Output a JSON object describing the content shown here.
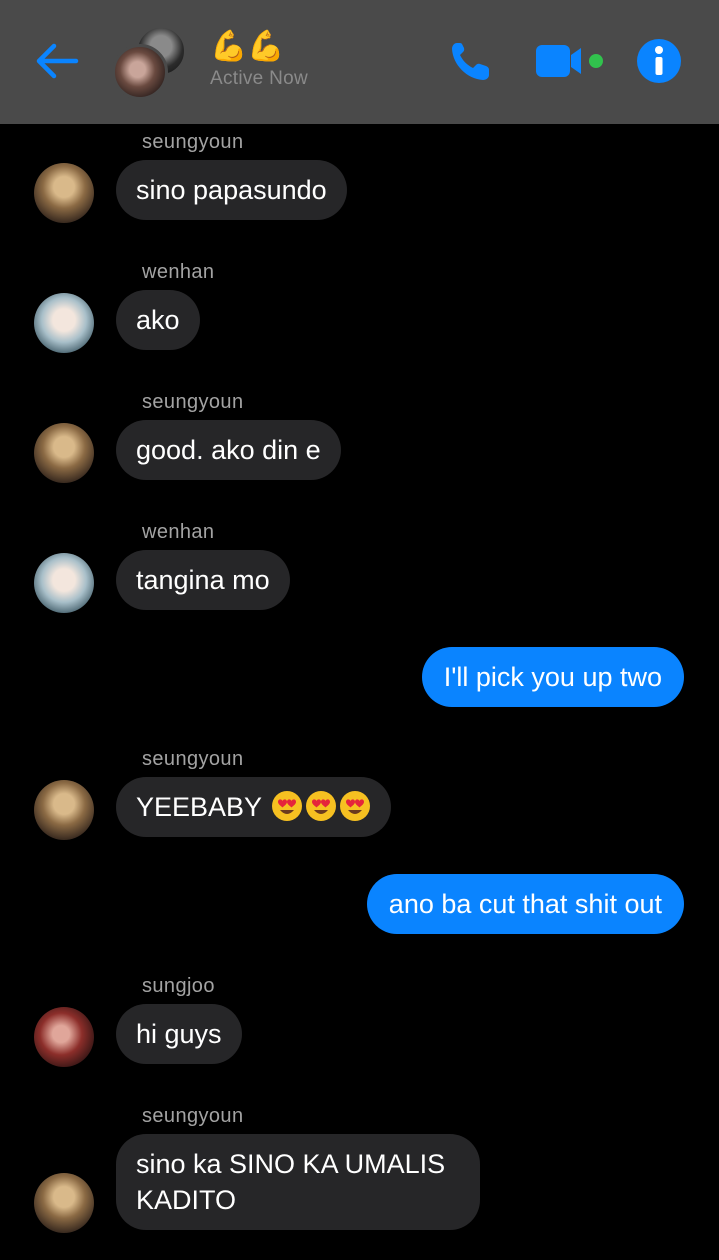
{
  "header": {
    "title": "💪💪",
    "status": "Active Now",
    "colors": {
      "accent": "#0a84ff",
      "online": "#31c24d",
      "header_bg": "#4a4a4a"
    },
    "icons": [
      "back-arrow-icon",
      "phone-icon",
      "video-camera-icon",
      "info-icon"
    ]
  },
  "messages": [
    {
      "sender": "seungyoun",
      "text": "sino papasundo"
    },
    {
      "sender": "wenhan",
      "text": "ako"
    },
    {
      "sender": "seungyoun",
      "text": "good. ako din e"
    },
    {
      "sender": "wenhan",
      "text": "tangina mo"
    },
    {
      "sender": "me",
      "text": "I'll pick you up two"
    },
    {
      "sender": "seungyoun",
      "text": "YEEBABY",
      "emoji": [
        "heart-eyes",
        "heart-eyes",
        "heart-eyes"
      ]
    },
    {
      "sender": "me",
      "text": "ano ba cut that shit out"
    },
    {
      "sender": "sungjoo",
      "text": "hi guys"
    },
    {
      "sender": "seungyoun",
      "text": "sino ka SINO KA UMALIS KADITO"
    }
  ]
}
